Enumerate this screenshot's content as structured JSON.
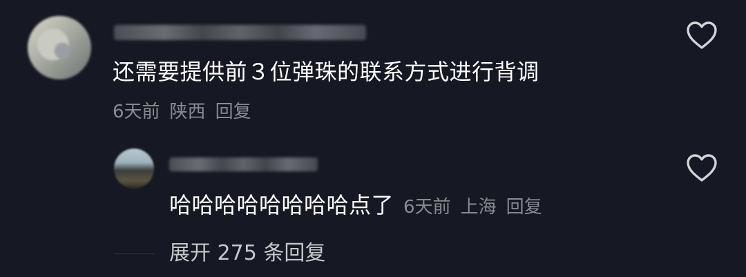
{
  "comment": {
    "text": "还需要提供前３位弹珠的联系方式进行背调",
    "time": "6天前",
    "location": "陕西",
    "reply_label": "回复",
    "avatar_icon": "user-avatar-icon",
    "like_icon": "heart-outline-icon"
  },
  "reply": {
    "text": "哈哈哈哈哈哈哈哈点了",
    "time": "6天前",
    "location": "上海",
    "reply_label": "回复",
    "avatar_icon": "user-avatar-icon",
    "like_icon": "heart-outline-icon"
  },
  "expand": {
    "label": "展开 275 条回复"
  },
  "colors": {
    "background": "#161823",
    "primary_text": "#ffffff",
    "secondary_text": "#8a8b91"
  }
}
